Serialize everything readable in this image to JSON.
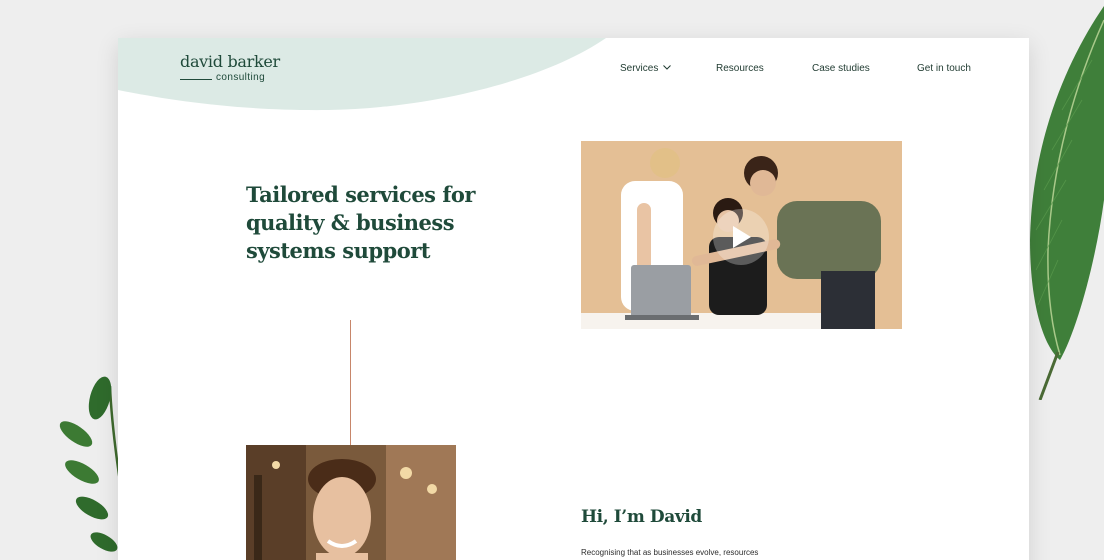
{
  "logo": {
    "name": "david barker",
    "sub": "consulting"
  },
  "nav": {
    "services": "Services",
    "resources": "Resources",
    "case_studies": "Case studies",
    "contact": "Get in touch"
  },
  "hero": {
    "title": "Tailored services for quality & business systems support"
  },
  "about": {
    "title": "Hi, I’m David",
    "body": "Recognising that as businesses evolve, resources"
  },
  "colors": {
    "brand_green": "#1f4a3a",
    "header_mint": "#dceae5",
    "accent_line": "#c7866a",
    "video_bg": "#e4bf95"
  },
  "icons": [
    "chevron-down-icon",
    "play-icon"
  ]
}
